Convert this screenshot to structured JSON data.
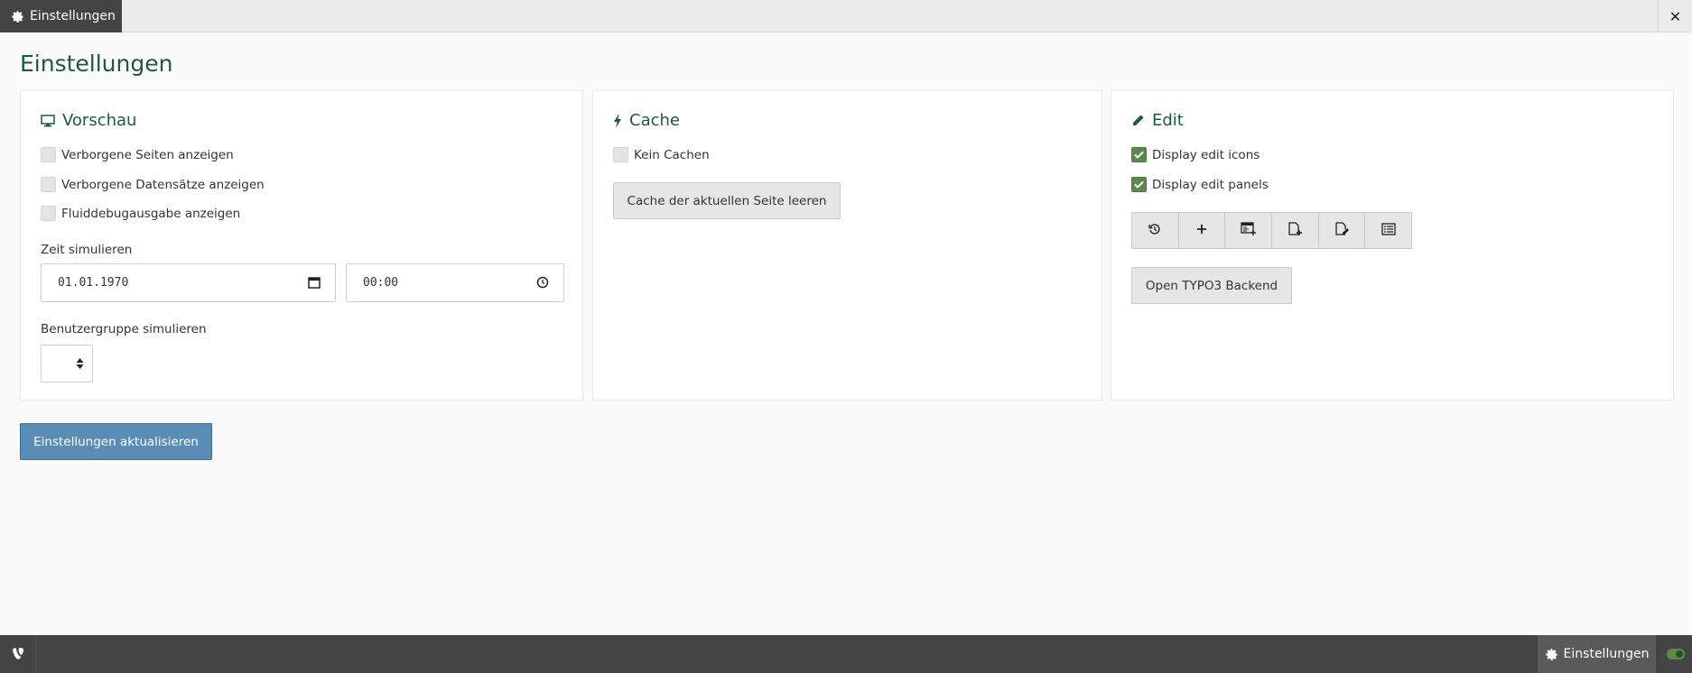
{
  "top": {
    "tab_label": "Einstellungen",
    "close_glyph": "✕"
  },
  "page": {
    "title": "Einstellungen"
  },
  "vorschau": {
    "title": "Vorschau",
    "icon": "monitor-icon",
    "checkboxes": [
      {
        "label": "Verborgene Seiten anzeigen",
        "checked": false
      },
      {
        "label": "Verborgene Datensätze anzeigen",
        "checked": false
      },
      {
        "label": "Fluiddebugausgabe anzeigen",
        "checked": false
      }
    ],
    "time_label": "Zeit simulieren",
    "date_value": "01.01.1970",
    "time_value": "00:00",
    "group_label": "Benutzergruppe simulieren"
  },
  "cache": {
    "title": "Cache",
    "icon": "bolt-icon",
    "checkbox": {
      "label": "Kein Cachen",
      "checked": false
    },
    "clear_button": "Cache der aktuellen Seite leeren"
  },
  "edit": {
    "title": "Edit",
    "icon": "pencil-icon",
    "checkboxes": [
      {
        "label": "Display edit icons",
        "checked": true
      },
      {
        "label": "Display edit panels",
        "checked": true
      }
    ],
    "toolbar_icons": [
      "history-icon",
      "plus-icon",
      "new-content-icon",
      "new-page-icon",
      "edit-page-icon",
      "list-icon"
    ],
    "backend_button": "Open TYPO3 Backend"
  },
  "actions": {
    "update_button": "Einstellungen aktualisieren"
  },
  "bottom": {
    "tab_label": "Einstellungen",
    "logo": "typo3-logo-icon",
    "toggle_on": true
  }
}
